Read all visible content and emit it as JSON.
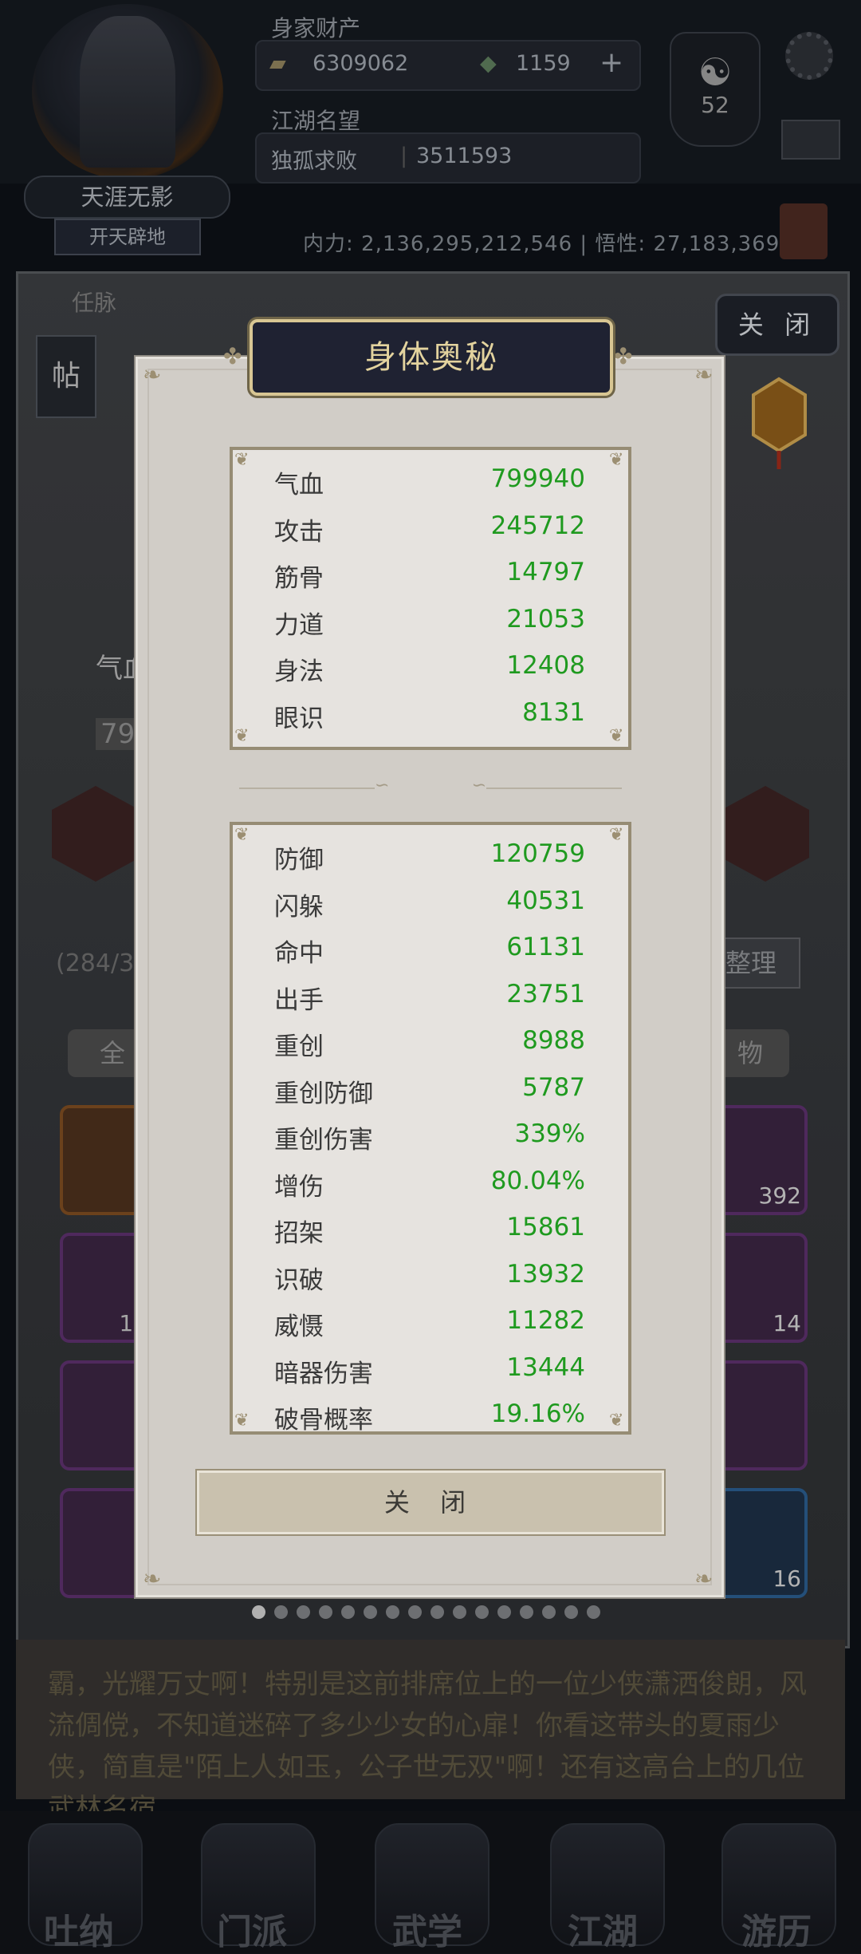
{
  "header": {
    "assets_label": "身家财产",
    "gold_value": "6309062",
    "jade_value": "1159",
    "plus_label": "+",
    "fame_label": "江湖名望",
    "title_name": "独孤求败",
    "fame_value": "3511593",
    "player_name": "天涯无影",
    "player_rank": "开天辟地",
    "level_badge": "52",
    "power_text": "内力: 2,136,295,212,546 | 悟性: 27,183,369",
    "meridian_label": "任脉"
  },
  "background": {
    "close_top_label": "关 闭",
    "tie_label": "帖",
    "hp_partial": "气血",
    "hp_value_partial": "79",
    "bag_count": "(284/38",
    "sort_label": "整理",
    "filter_all": "全",
    "filter_items": "物",
    "item_counts": [
      "392",
      "18",
      "14",
      "16"
    ],
    "story_text": "霸，光耀万丈啊！特别是这前排席位上的一位少侠潇洒俊朗，风流倜傥，不知道迷碎了多少少女的心扉！你看这带头的夏雨少侠，简直是\"陌上人如玉，公子世无双\"啊！还有这高台上的几位武林名宿",
    "page_dots": 16,
    "active_dot": 0
  },
  "nav": {
    "items": [
      {
        "label": "吐纳"
      },
      {
        "label": "门派"
      },
      {
        "label": "武学"
      },
      {
        "label": "江湖"
      },
      {
        "label": "游历"
      }
    ]
  },
  "modal": {
    "title": "身体奥秘",
    "primary_stats": [
      {
        "name": "气血",
        "value": "799940"
      },
      {
        "name": "攻击",
        "value": "245712"
      },
      {
        "name": "筋骨",
        "value": "14797"
      },
      {
        "name": "力道",
        "value": "21053"
      },
      {
        "name": "身法",
        "value": "12408"
      },
      {
        "name": "眼识",
        "value": "8131"
      }
    ],
    "secondary_stats": [
      {
        "name": "防御",
        "value": "120759"
      },
      {
        "name": "闪躲",
        "value": "40531"
      },
      {
        "name": "命中",
        "value": "61131"
      },
      {
        "name": "出手",
        "value": "23751"
      },
      {
        "name": "重创",
        "value": "8988"
      },
      {
        "name": "重创防御",
        "value": "5787"
      },
      {
        "name": "重创伤害",
        "value": "339%"
      },
      {
        "name": "增伤",
        "value": "80.04%"
      },
      {
        "name": "招架",
        "value": "15861"
      },
      {
        "name": "识破",
        "value": "13932"
      },
      {
        "name": "威慑",
        "value": "11282"
      },
      {
        "name": "暗器伤害",
        "value": "13444"
      },
      {
        "name": "破骨概率",
        "value": "19.16%"
      }
    ],
    "close_label": "关 闭"
  },
  "colors": {
    "stat_value": "#1f9a1f",
    "stat_name": "#3a3a3a",
    "title_text": "#e3d39e",
    "title_bg": "#1f2232"
  }
}
